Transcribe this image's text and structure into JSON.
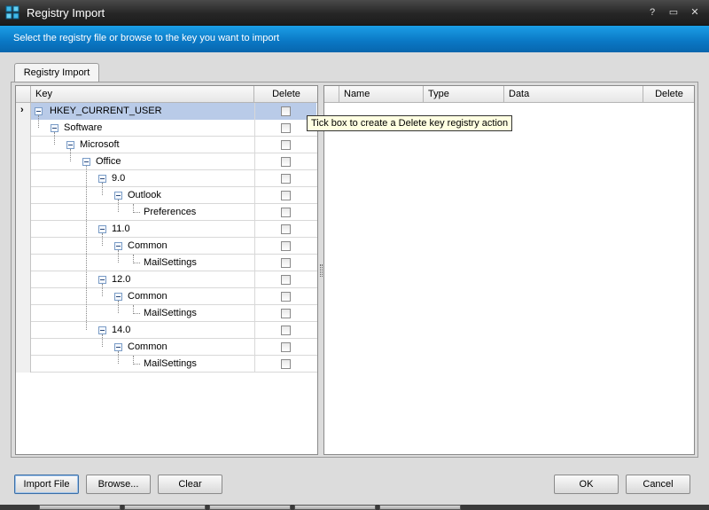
{
  "window": {
    "title": "Registry Import",
    "help_glyph": "?",
    "minimize_glyph": "▭",
    "close_glyph": "✕"
  },
  "banner": {
    "text": "Select the registry file or browse to the key you want to import"
  },
  "tabs": [
    {
      "label": "Registry Import",
      "active": true
    }
  ],
  "left_grid": {
    "headers": {
      "key": "Key",
      "delete": "Delete"
    },
    "rows": [
      {
        "label": "HKEY_CURRENT_USER",
        "level": 0,
        "has_children": true,
        "selected": true,
        "delete_checked": false
      },
      {
        "label": "Software",
        "level": 1,
        "has_children": true,
        "selected": false,
        "delete_checked": false
      },
      {
        "label": "Microsoft",
        "level": 2,
        "has_children": true,
        "selected": false,
        "delete_checked": false
      },
      {
        "label": "Office",
        "level": 3,
        "has_children": true,
        "selected": false,
        "delete_checked": false
      },
      {
        "label": "9.0",
        "level": 4,
        "has_children": true,
        "selected": false,
        "delete_checked": false
      },
      {
        "label": "Outlook",
        "level": 5,
        "has_children": true,
        "selected": false,
        "delete_checked": false
      },
      {
        "label": "Preferences",
        "level": 6,
        "has_children": false,
        "selected": false,
        "delete_checked": false
      },
      {
        "label": "11.0",
        "level": 4,
        "has_children": true,
        "selected": false,
        "delete_checked": false
      },
      {
        "label": "Common",
        "level": 5,
        "has_children": true,
        "selected": false,
        "delete_checked": false
      },
      {
        "label": "MailSettings",
        "level": 6,
        "has_children": false,
        "selected": false,
        "delete_checked": false
      },
      {
        "label": "12.0",
        "level": 4,
        "has_children": true,
        "selected": false,
        "delete_checked": false
      },
      {
        "label": "Common",
        "level": 5,
        "has_children": true,
        "selected": false,
        "delete_checked": false
      },
      {
        "label": "MailSettings",
        "level": 6,
        "has_children": false,
        "selected": false,
        "delete_checked": false
      },
      {
        "label": "14.0",
        "level": 4,
        "has_children": true,
        "selected": false,
        "delete_checked": false
      },
      {
        "label": "Common",
        "level": 5,
        "has_children": true,
        "selected": false,
        "delete_checked": false
      },
      {
        "label": "MailSettings",
        "level": 6,
        "has_children": false,
        "selected": false,
        "delete_checked": false
      }
    ]
  },
  "right_grid": {
    "headers": {
      "name": "Name",
      "type": "Type",
      "data": "Data",
      "delete": "Delete"
    }
  },
  "tooltip": {
    "text": "Tick box to create a Delete key registry action"
  },
  "buttons": {
    "import_file": "Import File",
    "browse": "Browse...",
    "clear": "Clear",
    "ok": "OK",
    "cancel": "Cancel"
  },
  "colors": {
    "title_bar": "#262626",
    "banner": "#0a77c4",
    "selection": "#b9cbe8",
    "tooltip_bg": "#ffffe1"
  }
}
